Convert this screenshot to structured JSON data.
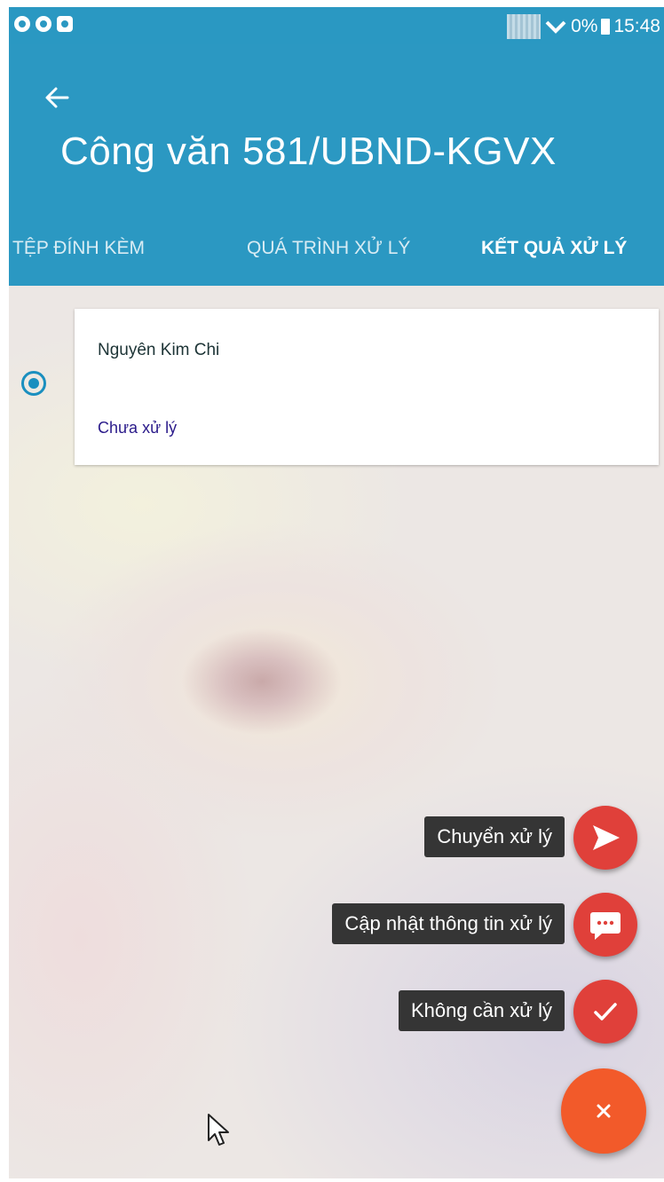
{
  "status_bar": {
    "battery_text": "0%",
    "time": "15:48",
    "icons": [
      "messenger-icon",
      "eye-icon",
      "teamviewer-icon"
    ]
  },
  "app_bar": {
    "back_icon": "arrow-left-icon",
    "title": "Công văn 581/UBND-KGVX"
  },
  "tabs": [
    {
      "label": "TỆP ĐÍNH KÈM",
      "active": false
    },
    {
      "label": "QUÁ TRÌNH XỬ LÝ",
      "active": false
    },
    {
      "label": "KẾT QUẢ XỬ LÝ",
      "active": true
    }
  ],
  "result_item": {
    "name": "Nguyên Kim Chi",
    "status": "Chưa xử lý",
    "selected": true
  },
  "fab_menu": {
    "items": [
      {
        "label": "Chuyển xử lý",
        "icon": "send-icon"
      },
      {
        "label": "Cập nhật thông tin xử lý",
        "icon": "comment-icon"
      },
      {
        "label": "Không cần xử lý",
        "icon": "check-icon"
      }
    ],
    "main_icon": "close-icon"
  },
  "colors": {
    "primary": "#2b98c2",
    "fab_mini": "#e0403a",
    "fab_main": "#f25a2a",
    "status_text": "#2a1a8a"
  }
}
